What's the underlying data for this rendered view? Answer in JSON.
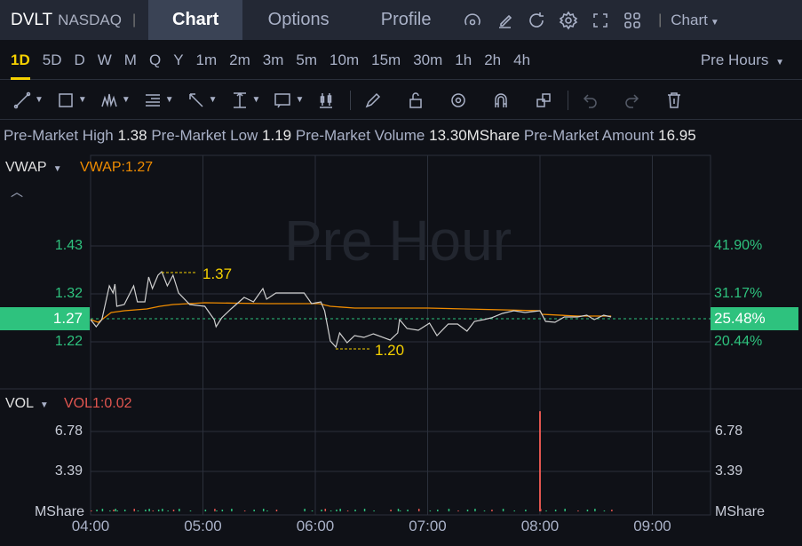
{
  "header": {
    "symbol": "DVLT",
    "exchange": "NASDAQ",
    "tabs": [
      "Chart",
      "Options",
      "Profile"
    ],
    "active_tab": "Chart",
    "chart_menu": "Chart"
  },
  "periods": {
    "items": [
      "1D",
      "5D",
      "D",
      "W",
      "M",
      "Q",
      "Y",
      "1m",
      "2m",
      "3m",
      "5m",
      "10m",
      "15m",
      "30m",
      "1h",
      "2h",
      "4h"
    ],
    "active": "1D",
    "session": "Pre Hours"
  },
  "stats": [
    {
      "label": "Pre-Market High",
      "value": "1.38"
    },
    {
      "label": "Pre-Market Low",
      "value": "1.19"
    },
    {
      "label": "Pre-Market Volume",
      "value": "13.30MShare"
    },
    {
      "label": "Pre-Market Amount",
      "value": "16.95"
    }
  ],
  "main": {
    "indicator": "VWAP",
    "indicator_value": "VWAP:1.27",
    "watermark": "Pre Hour",
    "price_labels": [
      "1.43",
      "1.32",
      "1.22"
    ],
    "pct_labels": [
      "41.90%",
      "31.17%",
      "20.44%"
    ],
    "current_price": "1.27",
    "current_pct": "25.48%",
    "high_marker": "1.37",
    "low_marker": "1.20"
  },
  "volume": {
    "indicator": "VOL",
    "indicator_value": "VOL1:0.02",
    "labels": [
      "6.78",
      "3.39",
      "MShare"
    ]
  },
  "colors": {
    "up": "#2ec27e",
    "vwap": "#f08c00",
    "price": "#d0d0d0",
    "marker": "#f5d000",
    "vol_spike": "#e0554f"
  },
  "chart_data": {
    "type": "line",
    "x_ticks": [
      "04:00",
      "05:00",
      "06:00",
      "07:00",
      "08:00",
      "09:00"
    ],
    "x_unit": "minutes since 04:00",
    "ylim": [
      1.18,
      1.46
    ],
    "price": [
      [
        0,
        1.262
      ],
      [
        3,
        1.246
      ],
      [
        6,
        1.262
      ],
      [
        10,
        1.338
      ],
      [
        12,
        1.322
      ],
      [
        13,
        1.342
      ],
      [
        14,
        1.292
      ],
      [
        18,
        1.296
      ],
      [
        23,
        1.338
      ],
      [
        25,
        1.302
      ],
      [
        29,
        1.302
      ],
      [
        31,
        1.358
      ],
      [
        33,
        1.332
      ],
      [
        36,
        1.362
      ],
      [
        38,
        1.37
      ],
      [
        41,
        1.338
      ],
      [
        44,
        1.362
      ],
      [
        47,
        1.322
      ],
      [
        53,
        1.296
      ],
      [
        61,
        1.292
      ],
      [
        66,
        1.262
      ],
      [
        67,
        1.246
      ],
      [
        70,
        1.266
      ],
      [
        75,
        1.286
      ],
      [
        82,
        1.312
      ],
      [
        87,
        1.302
      ],
      [
        92,
        1.332
      ],
      [
        94,
        1.308
      ],
      [
        99,
        1.322
      ],
      [
        114,
        1.322
      ],
      [
        118,
        1.298
      ],
      [
        123,
        1.302
      ],
      [
        125,
        1.282
      ],
      [
        128,
        1.214
      ],
      [
        131,
        1.2
      ],
      [
        133,
        1.232
      ],
      [
        137,
        1.21
      ],
      [
        141,
        1.226
      ],
      [
        146,
        1.222
      ],
      [
        151,
        1.23
      ],
      [
        160,
        1.216
      ],
      [
        164,
        1.232
      ],
      [
        165,
        1.262
      ],
      [
        169,
        1.242
      ],
      [
        175,
        1.238
      ],
      [
        181,
        1.254
      ],
      [
        185,
        1.226
      ],
      [
        191,
        1.252
      ],
      [
        196,
        1.252
      ],
      [
        201,
        1.236
      ],
      [
        205,
        1.258
      ],
      [
        210,
        1.262
      ],
      [
        214,
        1.266
      ],
      [
        220,
        1.276
      ],
      [
        226,
        1.282
      ],
      [
        232,
        1.278
      ],
      [
        240,
        1.282
      ],
      [
        243,
        1.258
      ],
      [
        248,
        1.256
      ],
      [
        253,
        1.268
      ],
      [
        260,
        1.268
      ],
      [
        265,
        1.272
      ],
      [
        269,
        1.262
      ],
      [
        274,
        1.272
      ],
      [
        278,
        1.268
      ]
    ],
    "vwap": [
      [
        0,
        1.262
      ],
      [
        4,
        1.256
      ],
      [
        6,
        1.262
      ],
      [
        11,
        1.278
      ],
      [
        18,
        1.282
      ],
      [
        30,
        1.286
      ],
      [
        37,
        1.292
      ],
      [
        44,
        1.296
      ],
      [
        61,
        1.3
      ],
      [
        94,
        1.298
      ],
      [
        122,
        1.298
      ],
      [
        128,
        1.292
      ],
      [
        141,
        1.288
      ],
      [
        180,
        1.288
      ],
      [
        240,
        1.282
      ],
      [
        241,
        1.274
      ],
      [
        260,
        1.27
      ],
      [
        278,
        1.27
      ]
    ],
    "volume_spike": {
      "minute": 240,
      "value": 8.5
    },
    "volume_ylim": [
      0,
      8.5
    ]
  }
}
